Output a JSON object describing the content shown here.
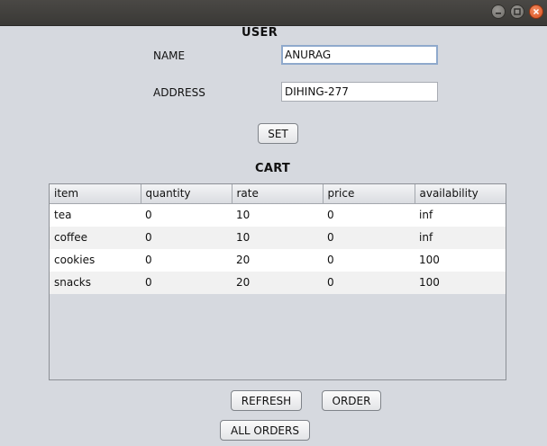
{
  "window": {
    "controls": [
      "minimize",
      "maximize",
      "close"
    ]
  },
  "user_section": {
    "title": "USER",
    "name_label": "NAME",
    "name_value": "ANURAG",
    "address_label": "ADDRESS",
    "address_value": "DIHING-277",
    "set_button": "SET"
  },
  "cart_section": {
    "title": "CART",
    "columns": [
      "item",
      "quantity",
      "rate",
      "price",
      "availability"
    ],
    "rows": [
      [
        "tea",
        "0",
        "10",
        "0",
        "inf"
      ],
      [
        "coffee",
        "0",
        "10",
        "0",
        "inf"
      ],
      [
        "cookies",
        "0",
        "20",
        "0",
        "100"
      ],
      [
        "snacks",
        "0",
        "20",
        "0",
        "100"
      ]
    ]
  },
  "actions": {
    "refresh_button": "REFRESH",
    "order_button": "ORDER",
    "all_orders_button": "ALL ORDERS"
  },
  "colors": {
    "background": "#d6d9df",
    "titlebar": "#3a3936",
    "close_button": "#e25a25",
    "focus_border": "#8fa9cc"
  }
}
